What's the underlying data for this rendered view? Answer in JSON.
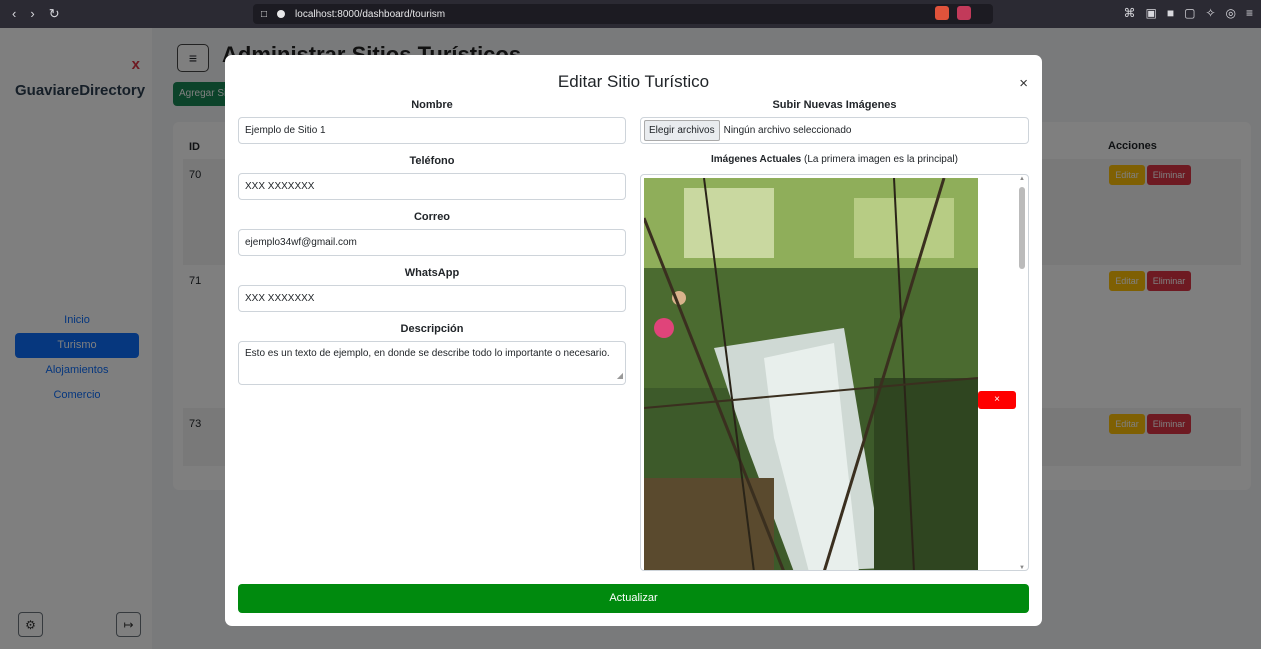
{
  "browser": {
    "url": "localhost:8000/dashboard/tourism"
  },
  "sidebar": {
    "close_symbol": "x",
    "brand": "GuaviareDirectory",
    "items": [
      {
        "label": "Inicio",
        "active": false
      },
      {
        "label": "Turismo",
        "active": true
      },
      {
        "label": "Alojamientos",
        "active": false
      },
      {
        "label": "Comercio",
        "active": false
      }
    ]
  },
  "background": {
    "page_title": "Administrar Sitios Turísticos",
    "add_button": "Agregar Sitio",
    "table": {
      "col_id": "ID",
      "col_actions": "Acciones",
      "rows": [
        {
          "id": "70",
          "edit": "Editar",
          "delete": "Eliminar"
        },
        {
          "id": "71",
          "edit": "Editar",
          "delete": "Eliminar"
        },
        {
          "id": "73",
          "edit": "Editar",
          "delete": "Eliminar"
        }
      ]
    }
  },
  "modal": {
    "title": "Editar Sitio Turístico",
    "close": "×",
    "fields": {
      "nombre_label": "Nombre",
      "nombre_value": "Ejemplo de Sitio 1",
      "telefono_label": "Teléfono",
      "telefono_value": "XXX XXXXXXX",
      "correo_label": "Correo",
      "correo_value": "ejemplo34wf@gmail.com",
      "whatsapp_label": "WhatsApp",
      "whatsapp_value": "XXX XXXXXXX",
      "descripcion_label": "Descripción",
      "descripcion_value": "Esto es un texto de ejemplo, en donde se describe todo lo importante o necesario."
    },
    "upload": {
      "label": "Subir Nuevas Imágenes",
      "button": "Elegir archivos",
      "status": "Ningún archivo seleccionado"
    },
    "current_images": {
      "label_bold": "Imágenes Actuales",
      "label_note": "(La primera imagen es la principal)",
      "remove_button": "×"
    },
    "submit": "Actualizar"
  },
  "colors": {
    "primary": "#0d6efd",
    "success": "#008a0e",
    "warning": "#ffc107",
    "danger": "#dc3545",
    "remove": "#ff0000"
  }
}
